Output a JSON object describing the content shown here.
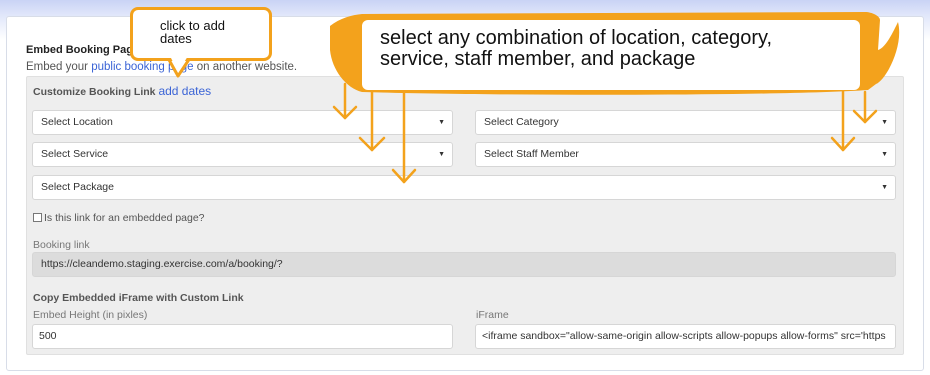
{
  "page": {
    "heading": "Embed Booking Page",
    "subtitle_prefix": "Embed your",
    "subtitle_link": "public booking page",
    "subtitle_suffix": "on another website."
  },
  "panel": {
    "customize_label": "Customize Booking Link",
    "add_dates_link": "add dates",
    "selects": {
      "location": "Select Location",
      "category": "Select Category",
      "service": "Select Service",
      "staff": "Select Staff Member",
      "package": "Select Package"
    },
    "checkbox_label": "Is this link for an embedded page?",
    "booking_link_label": "Booking link",
    "booking_link_value": "https://cleandemo.staging.exercise.com/a/booking/?",
    "copy_iframe_label": "Copy Embedded iFrame with Custom Link",
    "embed_height_label": "Embed Height (in pixles)",
    "embed_height_value": "500",
    "iframe_label": "iFrame",
    "iframe_value": "<iframe sandbox=\"allow-same-origin allow-scripts allow-popups allow-forms\" src='https"
  },
  "annotations": {
    "bubble_text_line1": "click to add",
    "bubble_text_line2": "dates",
    "banner_line1": "select any combination of location, category,",
    "banner_line2": "service, staff member, and package",
    "accent_color": "#f3a21c"
  },
  "icons": {
    "caret": "caret-down-icon",
    "checkbox": "checkbox-icon"
  }
}
